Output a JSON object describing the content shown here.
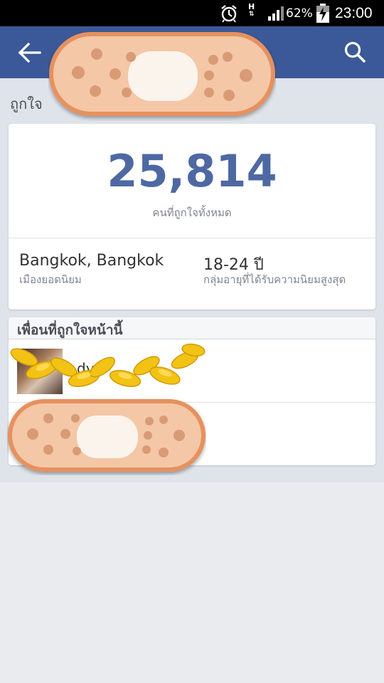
{
  "status_bar": {
    "network": "H",
    "battery_percent": "62%",
    "time": "23:00"
  },
  "app_bar": {
    "back_icon": "back-arrow-icon",
    "search_icon": "search-icon",
    "color": "#3b5998"
  },
  "page": {
    "section_title": "ถูกใจ"
  },
  "stats": {
    "total_likes": "25,814",
    "total_likes_caption": "คนที่ถูกใจทั้งหมด",
    "top_city": "Bangkok, Bangkok",
    "top_city_label": "เมืองยอดนิยม",
    "top_age": "18-24 ปี",
    "top_age_label": "กลุ่มอายุที่ได้รับความนิยมสูงสุด",
    "number_color": "#4e69a2"
  },
  "friends": {
    "title": "เพื่อนที่ถูกใจหน้านี้",
    "items": [
      {
        "name": "dy"
      },
      {
        "name": ""
      }
    ]
  }
}
